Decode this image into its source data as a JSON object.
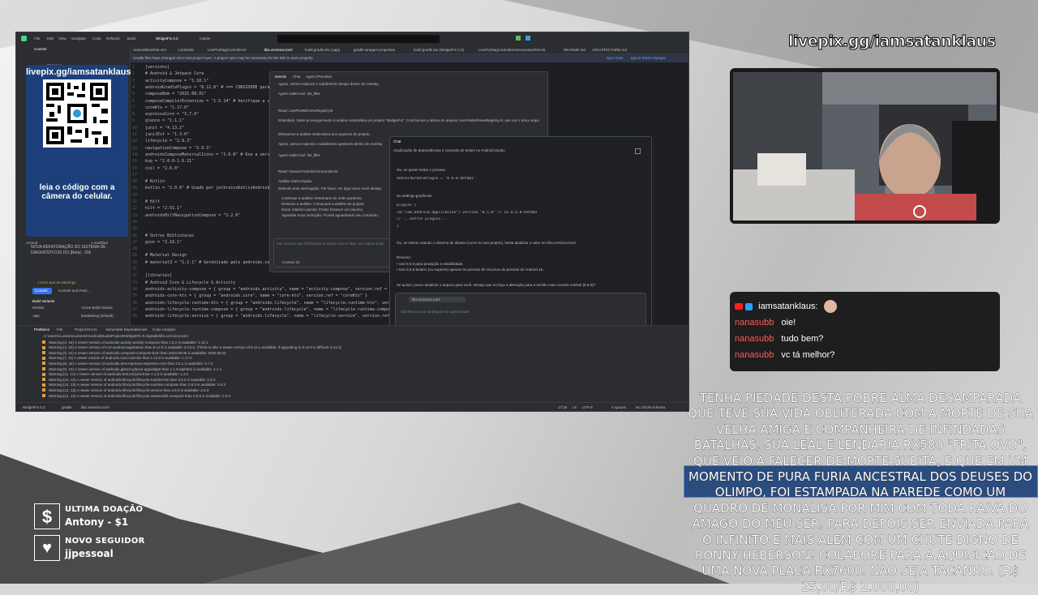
{
  "overlay": {
    "stream_url": "livepix.gg/iamsatanklaus",
    "chat": {
      "host_name": "iamsatanklaus:",
      "messages": [
        {
          "user": "nanasubb",
          "text": "oie!"
        },
        {
          "user": "nanasubb",
          "text": "tudo bem?"
        },
        {
          "user": "nanasubb",
          "text": "vc tá melhor?"
        }
      ]
    },
    "donation_message": {
      "before": "TENHA PIEDADE DESTA POBRE ALMA DESAMPARADA QUE TEVE SUA VIDA OBLITERADA COM A MORTE DE SUA VELHA AMIGA E COMPANHEIRA DE INFINDADAS BATALHAS, SUA LEAL E LENDARIA RX580 \"FRITA OVO\", QUE VEIO A FALECER DE MORTE SUBITA, E QUE EM UM MOMENTO DE PURA",
      "highlight": "FURIA ANCESTRAL DOS DEUSES DO OLIMPO, FOI ESTAMPADA NA PAREDE COMO UM QUADRO DE MONALISA",
      "after": "POR MIM COM TODA RAIVA DO AMAGO DO MEU SER, PARA DEPOIS SER ENVIADA PARA O INFINITO E MAIS ALEM COM UM CHUTE DIGNO DE RONNY HEBERSON! COLABORE PARA A AQUISICAO DE UMA NOVA PLACA RX7600. NAO SEJA TACANHO. (R$ 25,00/R$ 2.000,00)"
    },
    "last_donation": {
      "title": "ULTIMA DOAÇÃO",
      "value": "Antony - $1"
    },
    "new_follower": {
      "title": "NOVO SEGUIDOR",
      "value": "jjpessoal"
    },
    "qr": {
      "url": "livepix.gg/iamsatanklaus",
      "caption": "leia o código com a câmera do celular."
    }
  },
  "ide": {
    "menu": [
      "File",
      "Edit",
      "View",
      "Navigate",
      "Code",
      "Refactor",
      "Build"
    ],
    "project": "WidgetFix 0.3",
    "branch": "master",
    "tabs": [
      "AndroidManifest.xml",
      "LICENSE",
      "LivePixDiagController.kt",
      "libs.versions.toml",
      "build.gradle.kts (:app)",
      "gradle-wrapper.properties",
      "build.gradle.kts (WidgetFix 0.3)",
      "LivePixDiagControllerInstrumentedTest.kt",
      "README.md",
      "ARCHITECTURE.md"
    ],
    "notice": "Gradle files have changed since last project sync. A project sync may be necessary for the IDE to work properly.",
    "notice_actions": [
      "Sync Now",
      "Ignore these changes"
    ],
    "commit_header": "Commit",
    "changes_label": "Changes",
    "commit_message": "NOVA REFATORAÇÃO DO SISTEMA DE DIAGNÓSTICOS DO [Beta] - 20k",
    "amend_label": "Amend",
    "modified_label": "1 modified",
    "warnings_label": "1 error and 32 warnings",
    "commit_buttons": [
      "Commit",
      "Commit and Push..."
    ],
    "code_lines": [
      "[versions]",
      "# Android & Jetpack Core",
      "activityCompose = \"1.10.1\"",
      "androidGradlePlugin = \"8.12.0\"  # <== CONSIDERE para",
      "composeBom = \"2025.08.01\"",
      "composeCompilerExtension = \"1.5.14\" # Verifique a co",
      "coreKtx = \"1.17.0\"",
      "espressoCore = \"3.7.0\"",
      "glance = \"1.1.1\"",
      "junit = \"4.13.2\"",
      "junitExt = \"1.3.0\"",
      "lifecycle = \"2.9.3\"",
      "navigationCompose = \"2.9.3\"",
      "androidxComposeMaterialIcons = \"1.6.8\" # Use a versã",
      "ksp = \"2.0.0-1.0.21\"",
      "coil = \"2.6.0\"",
      "",
      "# Kotlin",
      "kotlin = \"2.0.0\" # Usado por jetbrainsKotlinAndroid e",
      "",
      "# Hilt",
      "hilt = \"2.51.1\"",
      "androidxHiltNavigationCompose = \"1.2.0\"",
      "",
      "",
      "# Outras Bibliotecas",
      "gson = \"2.10.1\"",
      "",
      "# Material Design",
      "# material3 = \"1.2.1\" # Gerenciado pelo androidx.comp",
      "",
      "[libraries]",
      "# Android Core & Lifecycle & Activity",
      "androidx-activity-compose = { group = \"androidx.activity\", name = \"activity-compose\", version.ref = \"",
      "androidx-core-ktx = { group = \"androidx.core\", name = \"core-ktx\", version.ref = \"coreKtx\" }",
      "androidx-lifecycle-runtime-ktx = { group = \"androidx.lifecycle\", name = \"lifecycle-runtime-ktx\", versi",
      "androidx-lifecycle-runtime-compose = { group = \"androidx.lifecycle\", name = \"lifecycle-runtime-compose",
      "androidx-lifecycle-service = { group = \"androidx.lifecycle\", name = \"lifecycle-service\", version.ref"
    ],
    "chat_panel_tabs": [
      "Gemini",
      "Chat",
      "Agent (Preview)"
    ],
    "chat_panel_text": [
      "Agora, vamos explorar o subdiretório livepix dentro de overlay.",
      "Agent called tool: list_files",
      "Read: LivePixWebViewRegistry.kt",
      "Entendido. Darei prosseguimento à análise sistemática do projeto \"WidgetFix\". Concluímos a leitura do arquivo LivePixWebViewRegistry.kt, que era o único arquivo no diretório overlay/livepix.",
      "Efetuamos a análise sistemática dos arquivos do projeto.",
      "Agora, vamos explorar o subdiretório gestures dentro de overlay.",
      "Agent called tool: list_files",
      "Read: GestureTransformController.kt",
      "Análise interrompida.",
      "Detectei uma interrupção. Por favor, me diga como você deseja:",
      "Continuar a análise: Retornarei de onde paramos.",
      "Reiniciar a análise: Começarei a análise do projeto.",
      "Gerar relatório parcial: Posso fornecer um resumo.",
      "Aguardar nova instrução: Ficarei aguardando seu comando."
    ],
    "chat_input_placeholder": "Ask Gemini, use @filename to chose source files, use Agent mode",
    "chat_context": "Context 22",
    "chat2_title": "Chat",
    "chat2_subtitle": "Atualização de dependências e correção de testes no Android Studio",
    "chat2_text": [
      "Ou, se quiser testar o preview:",
      "androidGradlePlugin = \"8.6.0-beta01\"",
      "No settings.gradle.kts:",
      "plugins {",
      "    id(\"com.android.application\") version \"8.5.0\" // ou 8.6.0-beta01",
      "    // ...outros plugins...",
      "}",
      "Ou, se estiver usando o sistema de aliases (como no seu projeto), basta atualizar o valor em libs.versions.toml.",
      "Resumo:",
      "• Use 8.5.0 para produção e estabilidade.",
      "• Use 8.6.0-beta01 (ou superior) apenas se precisar de recursos do preview do Android 15.",
      "Se quiser, posso atualizar o arquivo para você. Deseja que eu faça a alteração para a versão mais recente estável (8.5.0)?"
    ],
    "chat2_file_chip": "libs.versions.toml",
    "chat2_input_placeholder": "Edit files in your workspace in agent mode",
    "chat2_mode": "Agent",
    "chat2_model": "GPT-4.1",
    "problems_tabs": [
      "Problems",
      "File",
      "Project Errors",
      "Vulnerable Dependencies",
      "Code Analysis"
    ],
    "problems_path": "C:\\Users\\Luiza\\Documents\\AndroidStudioProjects\\WidgetFix 0.3\\gradle\\libs.versions.toml",
    "warnings": [
      "Warning:(3, 19)  A newer version of androidx.activity:activity-compose than 1.8.2 is available: 1.10.1",
      "Warning:(4, 23)  A newer version of com.android.application than 8.12.0 is available: 8.13.0. (There is also a newer version of 8.12.x available, if upgrading to 8.13.0 is difficult: 8.12.2)",
      "Warning:(5, 14)  A newer version of androidx.compose:compose-bom than 2024.05.00 is available: 2025.08.01",
      "Warning:(7, 11)  A newer version of androidx.core:core-ktx than 1.12.0 is available: 1.17.0",
      "Warning:(8, 16)  A newer version of androidx.test.espresso:espresso-core than 3.5.1 is available: 3.7.0",
      "Warning:(9, 10)  A newer version of androidx.glance:glance-appwidget than 1.1.0-alpha01 is available: 1.1.1",
      "Warning:(11, 12)  A newer version of androidx.test.ext:junit than 1.1.5 is available: 1.3.0",
      "Warning:(12, 13)  A newer version of androidx.lifecycle:lifecycle-runtime-ktx than 2.8.0 is available: 2.9.3",
      "Warning:(12, 13)  A newer version of androidx.lifecycle:lifecycle-runtime-compose than 2.8.0 is available: 2.9.3",
      "Warning:(12, 13)  A newer version of androidx.lifecycle:lifecycle-service than 2.8.0 is available: 2.9.3",
      "Warning:(12, 13)  A newer version of androidx.lifecycle:lifecycle-viewmodel-compose than 2.8.0 is available: 2.9.3"
    ],
    "build_variants": {
      "title": "Build Variants",
      "headers": [
        "Module",
        "Active Build Variant"
      ],
      "module": ":app",
      "variant": "betaDebug (default)"
    },
    "status_bar": [
      "WidgetFix 0.3",
      "gradle",
      "libs.versions.toml",
      "17:18",
      "LF",
      "UTF-8",
      "4 spaces",
      "No JSON schema"
    ]
  }
}
